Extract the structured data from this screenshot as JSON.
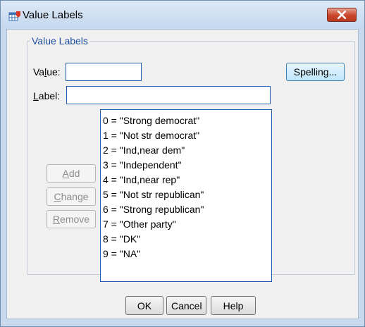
{
  "window": {
    "title": "Value Labels",
    "close_label": "Close"
  },
  "group": {
    "legend": "Value Labels"
  },
  "value_field": {
    "label_prefix": "Va",
    "label_mnemonic": "l",
    "label_suffix": "ue:",
    "value": ""
  },
  "label_field": {
    "label_mnemonic": "L",
    "label_suffix": "abel:",
    "value": ""
  },
  "buttons": {
    "spelling": "Spelling...",
    "add_mnemonic": "A",
    "add_rest": "dd",
    "change_mnemonic": "C",
    "change_rest": "hange",
    "remove_mnemonic": "R",
    "remove_rest": "emove",
    "ok": "OK",
    "cancel": "Cancel",
    "help": "Help"
  },
  "value_labels": [
    "0 = \"Strong democrat\"",
    "1 = \"Not str democrat\"",
    "2 = \"Ind,near dem\"",
    "3 = \"Independent\"",
    "4 = \"Ind,near rep\"",
    "5 = \"Not str republican\"",
    "6 = \"Strong republican\"",
    "7 = \"Other party\"",
    "8 = \"DK\"",
    "9 = \"NA\""
  ],
  "colors": {
    "accent": "#1f5fae",
    "legend_text": "#1f4e9c",
    "close_red": "#c9452a"
  }
}
